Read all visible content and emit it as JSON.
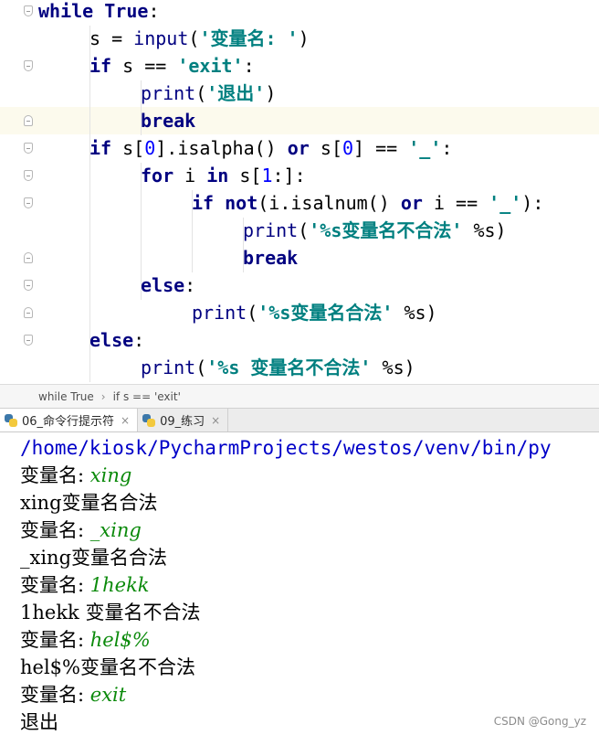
{
  "editor": {
    "lines": [
      {
        "indent": 0,
        "html": "<span class=\"kw\">while</span> <span class=\"kw\">True</span>:"
      },
      {
        "indent": 1,
        "html": "s = <span class=\"bi\">input</span>(<span class=\"st\">'变量名: '</span>)"
      },
      {
        "indent": 1,
        "html": "<span class=\"kw\">if</span> s == <span class=\"st\">'exit'</span>:"
      },
      {
        "indent": 2,
        "html": "<span class=\"bi\">print</span>(<span class=\"st\">'退出'</span>)"
      },
      {
        "indent": 2,
        "html": "<span class=\"kw\">break</span>"
      },
      {
        "indent": 1,
        "html": "<span class=\"kw\">if</span> s[<span class=\"nm\">0</span>].isalpha() <span class=\"kw\">or</span> s[<span class=\"nm\">0</span>] == <span class=\"st\">'_'</span>:"
      },
      {
        "indent": 2,
        "html": "<span class=\"kw\">for</span> i <span class=\"kw\">in</span> s[<span class=\"nm\">1</span>:]:"
      },
      {
        "indent": 3,
        "html": "<span class=\"kw\">if</span> <span class=\"kw\">not</span>(i.isalnum() <span class=\"kw\">or</span> i == <span class=\"st\">'_'</span>):"
      },
      {
        "indent": 4,
        "html": "<span class=\"bi\">print</span>(<span class=\"st\">'%s变量名不合法'</span> %s)"
      },
      {
        "indent": 4,
        "html": "<span class=\"kw\">break</span>"
      },
      {
        "indent": 2,
        "html": "<span class=\"kw\">else</span>:"
      },
      {
        "indent": 3,
        "html": "<span class=\"bi\">print</span>(<span class=\"st\">'%s变量名合法'</span> %s)"
      },
      {
        "indent": 1,
        "html": "<span class=\"kw\">else</span>:"
      },
      {
        "indent": 2,
        "html": "<span class=\"bi\">print</span>(<span class=\"st\">'%s 变量名不合法'</span> %s)"
      }
    ]
  },
  "breadcrumb": {
    "item1": "while True",
    "separator": "›",
    "item2": "if s == 'exit'"
  },
  "tabs": [
    {
      "label": "06_命令行提示符",
      "close": "×",
      "icon": "python-file-icon"
    },
    {
      "label": "09_练习",
      "close": "×",
      "icon": "python-file-icon"
    }
  ],
  "console": {
    "path": "/home/kiosk/PycharmProjects/westos/venv/bin/py",
    "lines": [
      {
        "prompt": "变量名: ",
        "input": "xing"
      },
      {
        "output": "xing变量名合法"
      },
      {
        "prompt": "变量名: ",
        "input": "_xing"
      },
      {
        "output": "_xing变量名合法"
      },
      {
        "prompt": "变量名: ",
        "input": "1hekk"
      },
      {
        "output": "1hekk 变量名不合法"
      },
      {
        "prompt": "变量名: ",
        "input": "hel$%"
      },
      {
        "output": "hel$%变量名不合法"
      },
      {
        "prompt": "变量名: ",
        "input": "exit"
      },
      {
        "output": "退出"
      }
    ]
  },
  "watermark": "CSDN @Gong_yz"
}
